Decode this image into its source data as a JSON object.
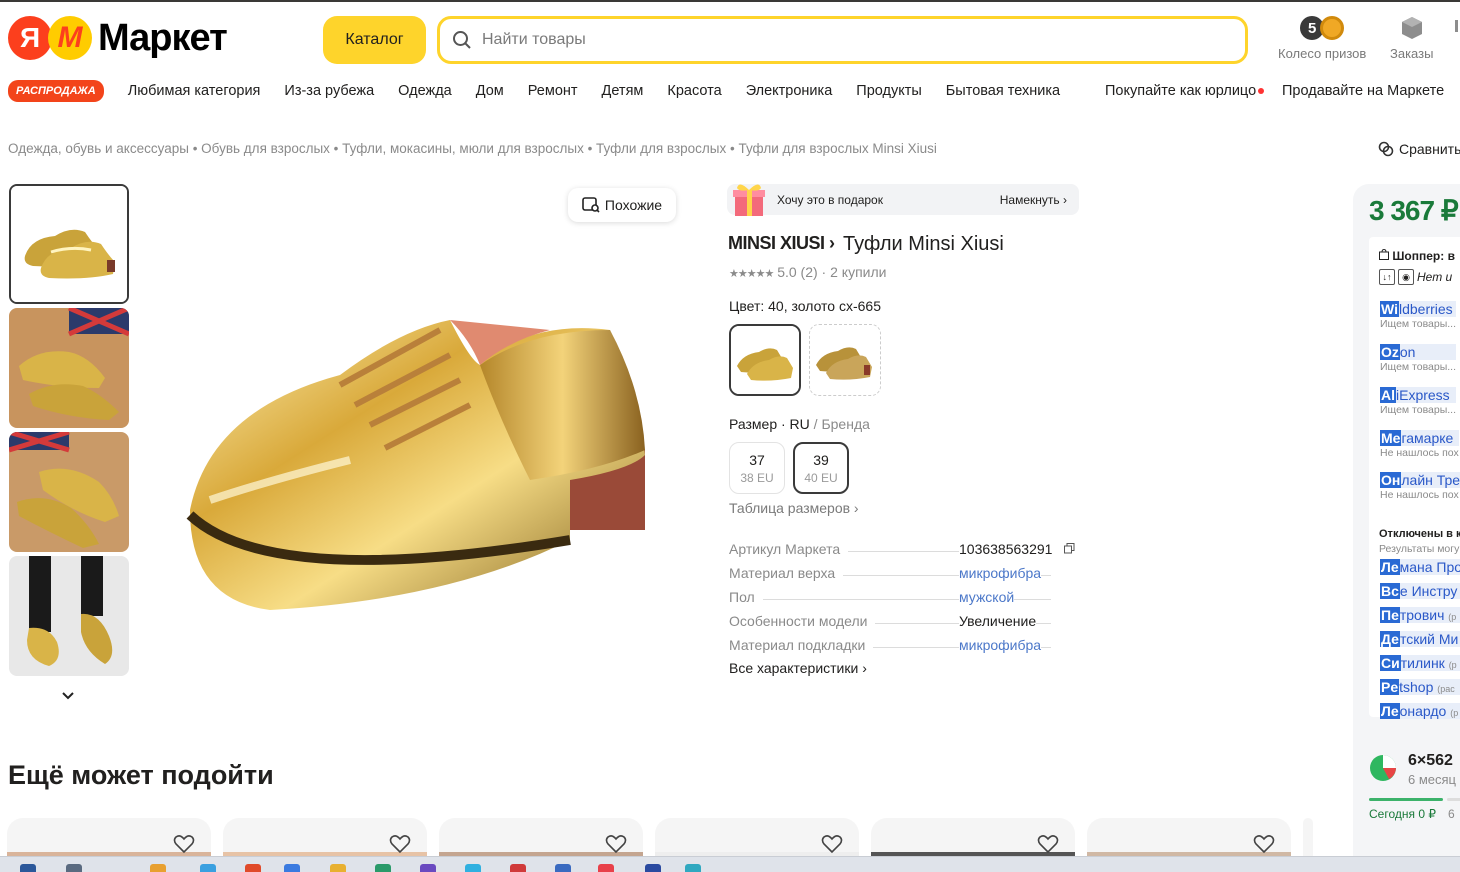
{
  "header": {
    "logo_ya": "Я",
    "logo_m": "M",
    "logo_word": "Маркет",
    "catalog_label": "Каталог",
    "search_placeholder": "Найти товары",
    "prize_count": "5",
    "prize_label": "Колесо призов",
    "orders_label": "Заказы",
    "accent_color": "#fed42b"
  },
  "nav": {
    "sale_label": "РАСПРОДАЖА",
    "items": [
      "Любимая категория",
      "Из-за рубежа",
      "Одежда",
      "Дом",
      "Ремонт",
      "Детям",
      "Красота",
      "Электроника",
      "Продукты",
      "Бытовая техника"
    ],
    "legal": "Покупайте как юрлицо",
    "sell": "Продавайте на Маркете"
  },
  "breadcrumbs": "Одежда, обувь и аксессуары • Обувь для взрослых • Туфли, мокасины, мюли для взрослых • Туфли для взрослых • Туфли для взрослых Minsi Xiusi",
  "compare_label": "Сравнить",
  "gallery": {
    "similar_label": "Похожие",
    "thumbnails": [
      "shoe-pair-gold",
      "shoe-pair-gold-flag",
      "shoe-pair-gold-flag",
      "shoe-worn-gold"
    ]
  },
  "product": {
    "gift_text": "Хочу это в подарок",
    "gift_hint": "Намекнуть",
    "brand": "MINSI XIUSI",
    "title": "Туфли Minsi Xiusi",
    "rating_text": "5.0 (2) · 2 купили",
    "rating_value": 5.0,
    "color_label": "Цвет: 40, золото сх-665",
    "size_label": "Размер · RU",
    "size_label_alt": " / Бренда",
    "sizes": [
      {
        "ru": "37",
        "eu": "38 EU"
      },
      {
        "ru": "39",
        "eu": "40 EU"
      }
    ],
    "size_table_label": "Таблица размеров",
    "specs": [
      {
        "key": "Артикул Маркета",
        "value": "103638563291"
      },
      {
        "key": "Материал верха",
        "value": "микрофибра"
      },
      {
        "key": "Пол",
        "value": "мужской"
      },
      {
        "key": "Особенности модели",
        "value": "Увеличение"
      },
      {
        "key": "Материал подкладки",
        "value": "микрофибра"
      }
    ],
    "all_specs_label": "Все характеристики"
  },
  "panel": {
    "price": "3 367 ₽",
    "shopper_title": "Шоппер: в",
    "shopper_tool": "Нет и",
    "stores": [
      {
        "hl": "Wi",
        "rest": "ldberries",
        "sub": "Ищем товары..."
      },
      {
        "hl": "Oz",
        "rest": "on",
        "sub": "Ищем товары..."
      },
      {
        "hl": "Al",
        "rest": "iExpress",
        "sub": "Ищем товары..."
      },
      {
        "hl": "Ме",
        "rest": "гамарке",
        "sub": "Не нашлось пох"
      },
      {
        "hl": "Он",
        "rest": "лайн Тре",
        "sub": "Не нашлось пох"
      }
    ],
    "disabled_title": "Отключены в к",
    "disabled_sub": "Результаты могу",
    "disabled_stores": [
      {
        "hl": "Ле",
        "rest": "мана Про",
        "sm": ""
      },
      {
        "hl": "Вс",
        "rest": "е Инстру",
        "sm": ""
      },
      {
        "hl": "Пе",
        "rest": "трович",
        "sm": "(р"
      },
      {
        "hl": "Де",
        "rest": "тский Ми",
        "sm": ""
      },
      {
        "hl": "Си",
        "rest": "тилинк",
        "sm": "(р"
      },
      {
        "hl": "Pe",
        "rest": "tshop",
        "sm": "(рас"
      },
      {
        "hl": "Ле",
        "rest": "онардо",
        "sm": "(р"
      }
    ],
    "split_amount": "6×562",
    "split_period": "6 месяц",
    "split_today": "Сегодня 0 ₽",
    "split_next": "6",
    "price_color": "#1a7a3a"
  },
  "recommend": {
    "title": "Ещё может подойти"
  }
}
